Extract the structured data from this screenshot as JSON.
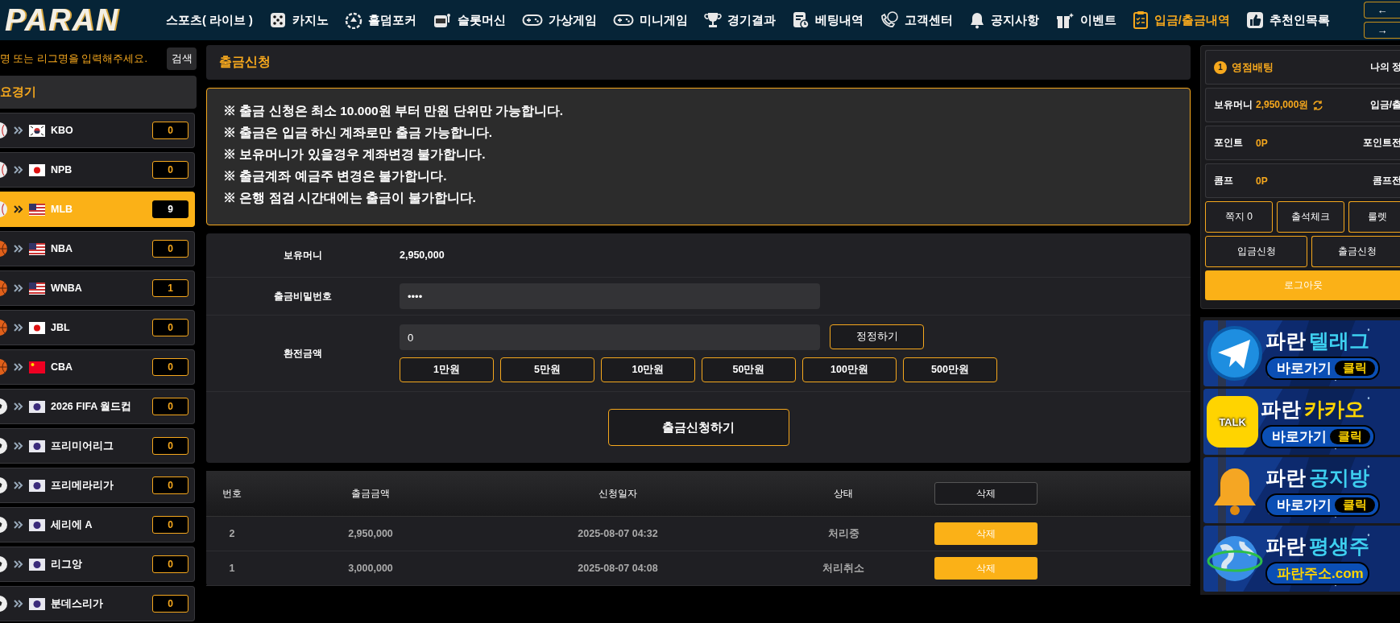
{
  "logo": "PARAN",
  "nav": {
    "items": [
      {
        "label": "스포츠( 라이브 )",
        "selected": false
      },
      {
        "label": "카지노",
        "selected": false
      },
      {
        "label": "홀덤포커",
        "selected": false
      },
      {
        "label": "슬롯머신",
        "selected": false
      },
      {
        "label": "가상게임",
        "selected": false
      },
      {
        "label": "미니게임",
        "selected": false
      },
      {
        "label": "경기결과",
        "selected": false
      },
      {
        "label": "베팅내역",
        "selected": false
      },
      {
        "label": "고객센터",
        "selected": false
      },
      {
        "label": "공지사항",
        "selected": false
      },
      {
        "label": "이벤트",
        "selected": false
      },
      {
        "label": "입금/출금내역",
        "selected": true
      },
      {
        "label": "추천인목록",
        "selected": false
      }
    ],
    "arrows": [
      "←",
      "→"
    ]
  },
  "sidebar": {
    "search": {
      "placeholder": "명 또는 리그명을 입력해주세요.",
      "button": "검색"
    },
    "heading": "요경기",
    "leagues": [
      {
        "name": "KBO",
        "count": "0",
        "selected": false
      },
      {
        "name": "NPB",
        "count": "0",
        "selected": false
      },
      {
        "name": "MLB",
        "count": "9",
        "selected": true
      },
      {
        "name": "NBA",
        "count": "0",
        "selected": false
      },
      {
        "name": "WNBA",
        "count": "1",
        "selected": false
      },
      {
        "name": "JBL",
        "count": "0",
        "selected": false
      },
      {
        "name": "CBA",
        "count": "0",
        "selected": false
      },
      {
        "name": "2026 FIFA 월드컵",
        "count": "0",
        "selected": false
      },
      {
        "name": "프리미어리그",
        "count": "0",
        "selected": false
      },
      {
        "name": "프리메라리가",
        "count": "0",
        "selected": false
      },
      {
        "name": "세리에 A",
        "count": "0",
        "selected": false
      },
      {
        "name": "리그앙",
        "count": "0",
        "selected": false
      },
      {
        "name": "분데스리가",
        "count": "0",
        "selected": false
      }
    ]
  },
  "main": {
    "title": "출금신청",
    "notices": [
      "※ 출금 신청은 최소 10.000원 부터 만원 단위만 가능합니다.",
      "※ 출금은 입금 하신 계좌로만 출금 가능합니다.",
      "※ 보유머니가 있을경우 계좌변경 불가합니다.",
      "※ 출금계좌 예금주 변경은 불가합니다.",
      "※ 은행 점검 시간대에는 출금이 불가합니다."
    ],
    "form": {
      "balance_label": "보유머니",
      "balance": "2,950,000",
      "password_label": "출금비밀번호",
      "password": "••••",
      "amount_label": "환전금액",
      "amount": "0",
      "reset_button": "정정하기",
      "quick_amounts": [
        "1만원",
        "5만원",
        "10만원",
        "50만원",
        "100만원",
        "500만원"
      ],
      "submit": "출금신청하기"
    },
    "table": {
      "columns": [
        "번호",
        "출금금액",
        "신청일자",
        "상태"
      ],
      "header_button": "삭제",
      "rows": [
        {
          "no": "2",
          "amount": "2,950,000",
          "date": "2025-08-07 04:32",
          "status": "처리중",
          "button": "삭제"
        },
        {
          "no": "1",
          "amount": "3,000,000",
          "date": "2025-08-07 04:08",
          "status": "처리취소",
          "button": "삭제"
        }
      ]
    }
  },
  "account": {
    "level_badge": "1",
    "level_name": "영점배팅",
    "my_info": "나의 정",
    "rows": [
      {
        "label": "보유머니",
        "value": "2,950,000원",
        "refresh": true,
        "link": "입금/출"
      },
      {
        "label": "포인트",
        "value": "0P",
        "refresh": false,
        "link": "포인트전"
      },
      {
        "label": "콤프",
        "value": "0P",
        "refresh": false,
        "link": "콤프전"
      }
    ],
    "buttons_row1": [
      "쪽지 0",
      "출석체크",
      "룰렛"
    ],
    "buttons_row2": [
      "입금신청",
      "출금신청"
    ],
    "logout": "로그아웃"
  },
  "banners": [
    {
      "title": "파란",
      "accent": "텔래그",
      "button": "바로가기",
      "tag": "클릭"
    },
    {
      "badge": "TALK",
      "title": "파란",
      "accent": "카카오",
      "button": "바로가기",
      "tag": "클릭"
    },
    {
      "title": "파란",
      "accent": "공지방",
      "button": "바로가기",
      "tag": "클릭"
    },
    {
      "title": "파란",
      "accent": "평생주",
      "button": "파란주소.com"
    }
  ]
}
